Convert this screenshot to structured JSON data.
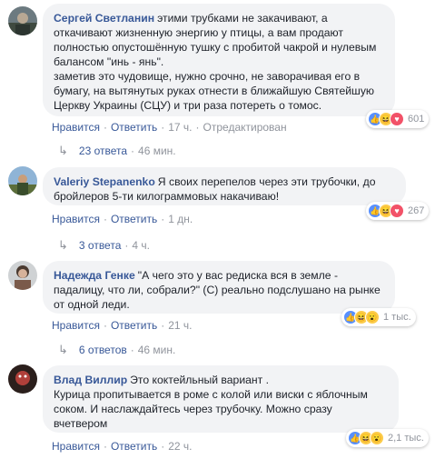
{
  "comments": [
    {
      "author": "Сергей Светланин",
      "lines": [
        "этими трубками не закачивают, а",
        "откачивают жизненную энергию у птицы, а вам продают",
        "полностью опустошённую тушку с пробитой чакрой и нулевым",
        "балансом \"инь - янь\".",
        "заметив это чудовище, нужно срочно, не заворачивая его в",
        "бумагу, на вытянутых руках отнести в ближайшую Святейшую",
        "Церкву Украины (СЦУ) и три раза потереть о томос."
      ],
      "reaction_count": "601",
      "like_label": "Нравится",
      "reply_label": "Ответить",
      "time": "17 ч.",
      "edited": "Отредактирован",
      "replies_label": "23 ответа",
      "replies_time": "46 мин."
    },
    {
      "author": "Valeriy Stepanenko",
      "lines": [
        "Я своих перепелов через эти трубочки, до",
        "бройлеров 5-ти килограммовых накачиваю!"
      ],
      "reaction_count": "267",
      "like_label": "Нравится",
      "reply_label": "Ответить",
      "time": "1 дн.",
      "replies_label": "3 ответа",
      "replies_time": "4 ч."
    },
    {
      "author": "Надежда Генке",
      "lines": [
        "\"А чего это у вас редиска вся в земле -",
        "падалицу, что ли, собрали?\" (С) реально подслушано на рынке",
        "от одной леди."
      ],
      "reaction_count": "1 тыс.",
      "like_label": "Нравится",
      "reply_label": "Ответить",
      "time": "21 ч.",
      "replies_label": "6 ответов",
      "replies_time": "46 мин."
    },
    {
      "author": "Влад Виллир",
      "lines": [
        "Это коктейльный вариант .",
        "Курица пропитывается в роме с колой или виски с яблочным",
        "соком. И наслаждайтесь через трубочку. Можно сразу",
        "вчетвером"
      ],
      "reaction_count": "2,1 тыс.",
      "like_label": "Нравится",
      "reply_label": "Ответить",
      "time": "22 ч."
    }
  ],
  "colors": {
    "link": "#385898",
    "bubble": "#f2f3f5",
    "meta": "#90949c",
    "like": "#5890ff",
    "love": "#f25268",
    "haha": "#fccc4a"
  }
}
